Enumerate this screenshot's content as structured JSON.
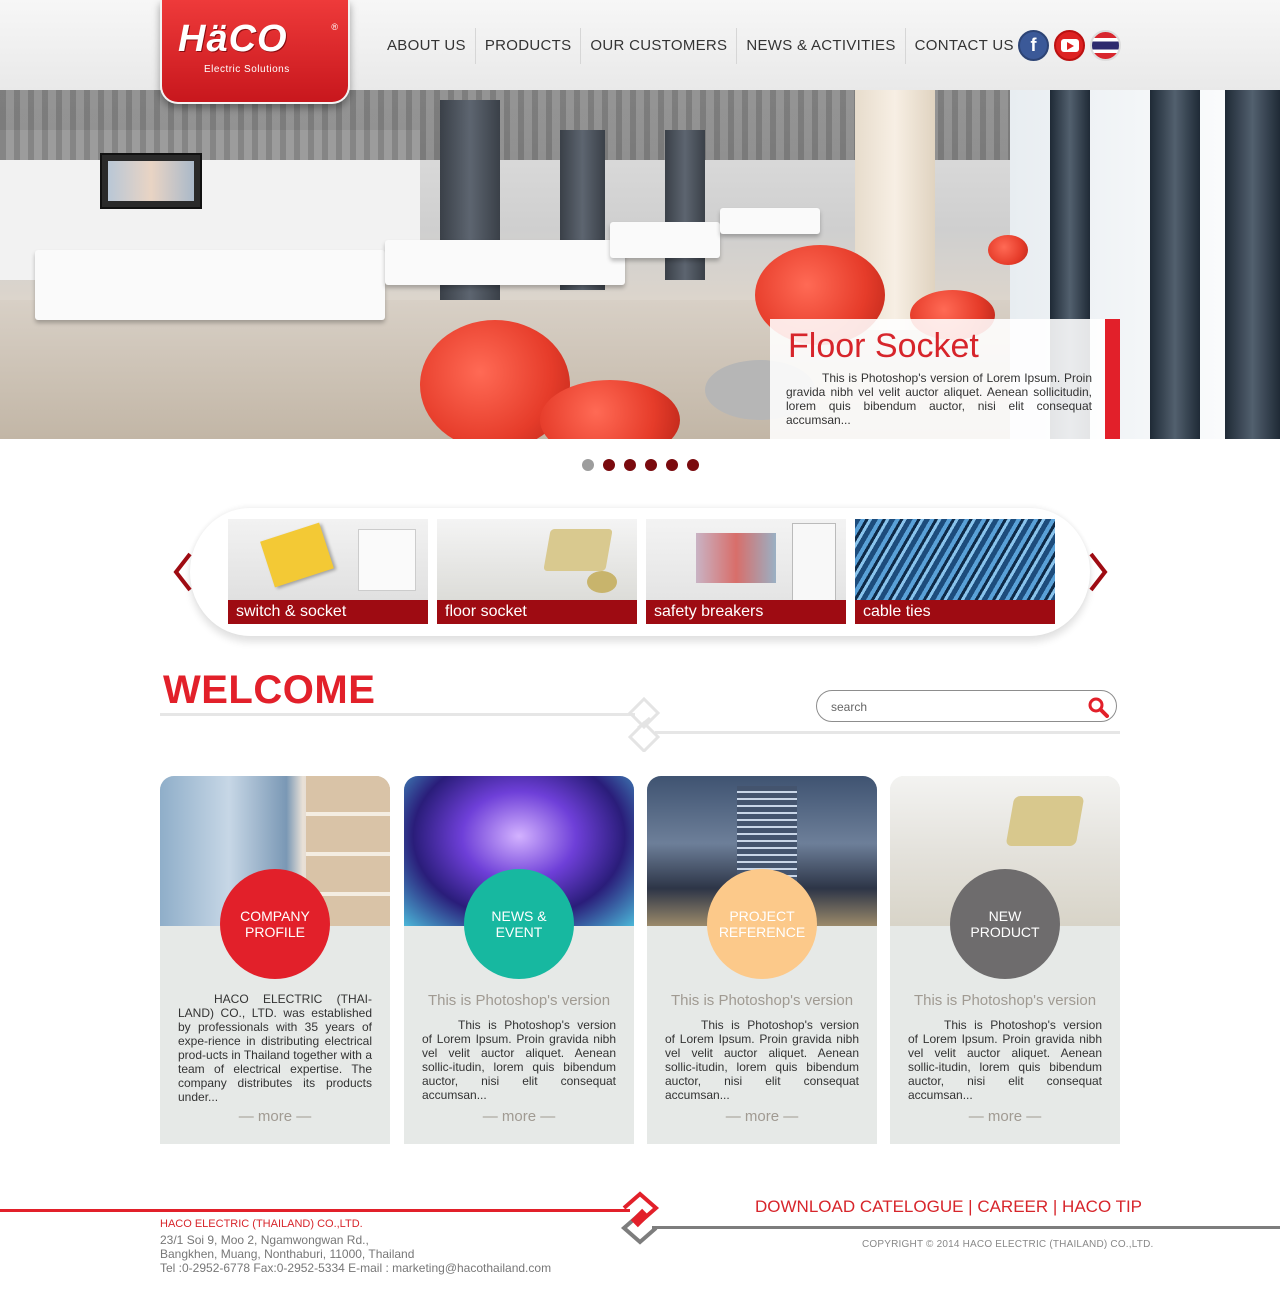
{
  "brand": {
    "logo_text": "HäCO",
    "registered": "®",
    "tagline": "Electric Solutions",
    "color_primary": "#e2202a",
    "color_dark_red": "#9e0b12"
  },
  "nav": {
    "items": [
      {
        "label": "ABOUT US"
      },
      {
        "label": "PRODUCTS"
      },
      {
        "label": "OUR CUSTOMERS"
      },
      {
        "label": "NEWS & ACTIVITIES"
      },
      {
        "label": "CONTACT US"
      }
    ]
  },
  "social": {
    "facebook": {
      "icon": "facebook-icon",
      "glyph": "f"
    },
    "youtube": {
      "icon": "youtube-icon"
    },
    "language": {
      "icon": "thai-flag-icon"
    }
  },
  "hero": {
    "title": "Floor Socket",
    "text": "This is Photoshop's version  of Lorem Ipsum. Proin gravida nibh vel velit auctor aliquet. Aenean sollicitudin, lorem quis bibendum auctor, nisi elit consequat accumsan...",
    "slide_count": 6,
    "active_slide": 1
  },
  "categories": {
    "items": [
      {
        "label": "switch & socket"
      },
      {
        "label": "floor socket"
      },
      {
        "label": "safety breakers"
      },
      {
        "label": "cable ties"
      }
    ]
  },
  "welcome": {
    "title": "WELCOME"
  },
  "search": {
    "placeholder": "search"
  },
  "cards": [
    {
      "badge": "COMPANY PROFILE",
      "subtitle": "",
      "text": "HACO ELECTRIC (THAI-LAND) CO., LTD. was established by professionals with 35 years of expe-rience in distributing electrical prod-ucts in Thailand together with a team of electrical expertise. The company distributes its products under...",
      "more": "more"
    },
    {
      "badge": "NEWS & EVENT",
      "subtitle": "This is Photoshop's version",
      "text": "This is Photoshop's version of Lorem Ipsum. Proin gravida nibh vel velit auctor aliquet. Aenean sollic-itudin, lorem quis bibendum auctor, nisi elit consequat accumsan...",
      "more": "more"
    },
    {
      "badge": "PROJECT REFERENCE",
      "subtitle": "This is Photoshop's version",
      "text": "This is Photoshop's version of Lorem Ipsum. Proin gravida nibh vel velit auctor aliquet. Aenean sollic-itudin, lorem quis bibendum auctor, nisi elit consequat accumsan...",
      "more": "more"
    },
    {
      "badge": "NEW PRODUCT",
      "subtitle": "This is Photoshop's version",
      "text": "This is Photoshop's version of Lorem Ipsum. Proin gravida nibh vel velit auctor aliquet. Aenean sollic-itudin, lorem quis bibendum auctor, nisi elit consequat accumsan...",
      "more": "more"
    }
  ],
  "footer": {
    "company": "HACO ELECTRIC (THAILAND) CO.,LTD.",
    "address_1": "23/1 Soi 9, Moo 2, Ngamwongwan Rd.,",
    "address_2": "Bangkhen, Muang, Nonthaburi, 11000, Thailand",
    "contact": "Tel :0-2952-6778 Fax:0-2952-5334 E-mail : marketing@hacothailand.com",
    "links": [
      "DOWNLOAD CATELOGUE",
      "CAREER",
      "HACO TIP"
    ],
    "separator": " | ",
    "copyright": "COPYRIGHT © 2014 HACO ELECTRIC (THAILAND) CO.,LTD."
  }
}
